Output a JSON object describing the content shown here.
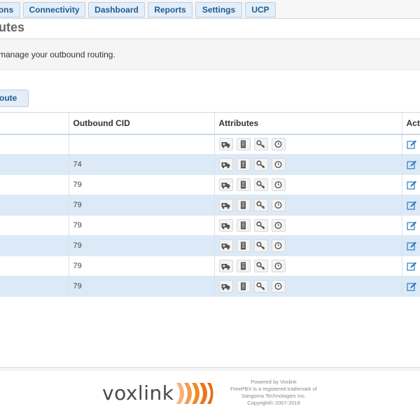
{
  "nav": {
    "tabs": [
      {
        "label": "ons"
      },
      {
        "label": "Connectivity"
      },
      {
        "label": "Dashboard"
      },
      {
        "label": "Reports"
      },
      {
        "label": "Settings"
      },
      {
        "label": "UCP"
      }
    ]
  },
  "page": {
    "title": "utes",
    "description": "manage your outbound routing.",
    "add_button_label": "oute"
  },
  "table": {
    "headers": {
      "outbound_cid": "Outbound CID",
      "attributes": "Attributes",
      "actions": "Acti"
    },
    "rows": [
      {
        "outbound_cid": ""
      },
      {
        "outbound_cid": "74"
      },
      {
        "outbound_cid": "79"
      },
      {
        "outbound_cid": "79"
      },
      {
        "outbound_cid": "79"
      },
      {
        "outbound_cid": "79"
      },
      {
        "outbound_cid": "79"
      },
      {
        "outbound_cid": "79"
      }
    ],
    "attribute_icons": [
      "ambulance-icon",
      "server-icon",
      "key-icon",
      "clock-icon"
    ],
    "action_icon": "edit-icon"
  },
  "footer": {
    "brand": "voxlink",
    "powered_by": "Powered by Voxlink",
    "trademark_line1": "FreePBX is a registered trademark of",
    "trademark_line2": "Sangoma Technologies Inc.",
    "copyright": "Copyright© 2007-2018"
  },
  "colors": {
    "accent": "#1f5c91",
    "tab_bg": "#e4eef8",
    "row_alt": "#dce9f7",
    "logo_orange": "#f08a24"
  }
}
